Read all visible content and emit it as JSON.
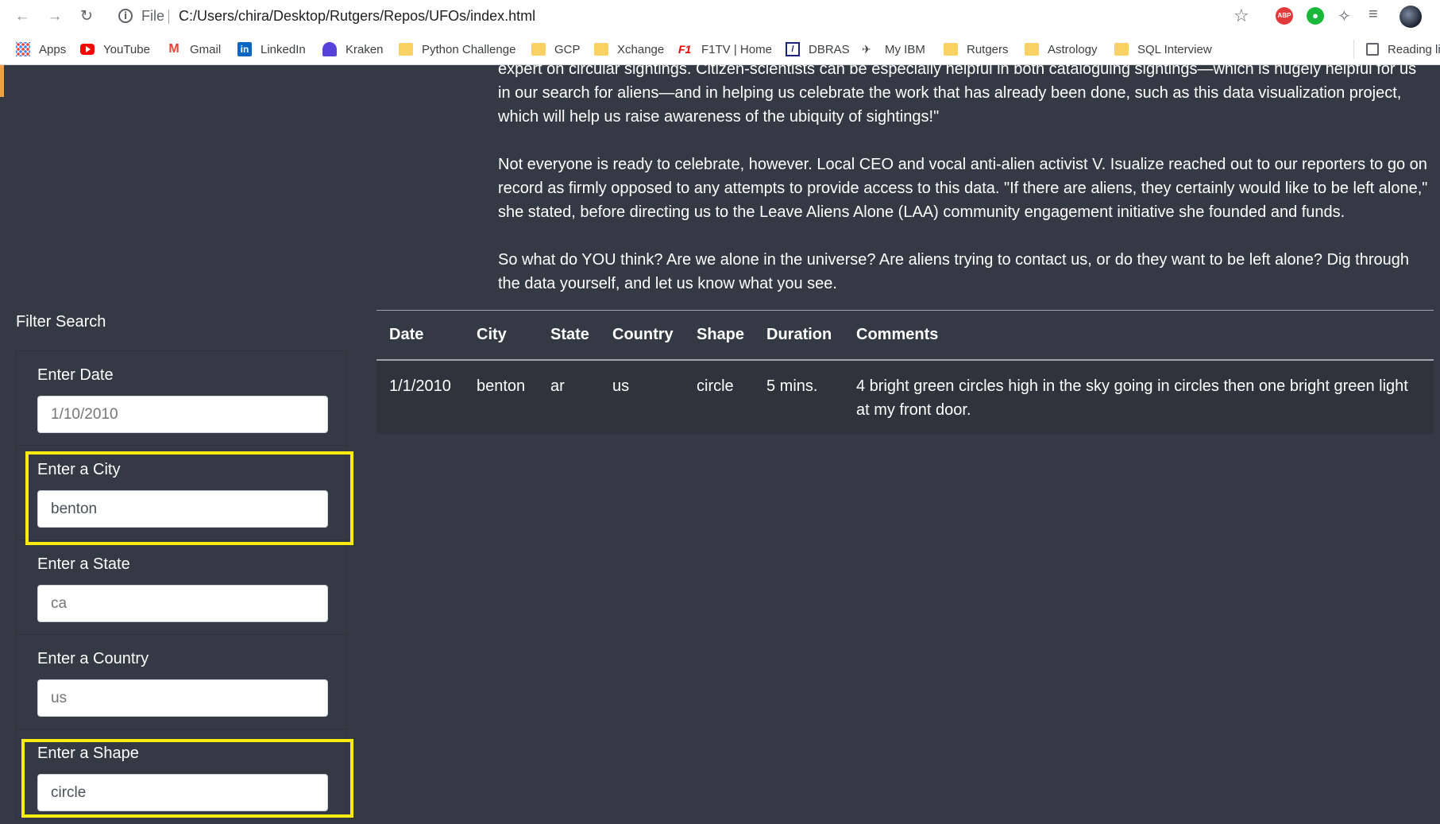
{
  "browser": {
    "scheme": "File",
    "url": "C:/Users/chira/Desktop/Rutgers/Repos/UFOs/index.html",
    "abp_label": "ABP",
    "bookmarks": [
      {
        "label": "Apps",
        "icon": "apps-grid-icon"
      },
      {
        "label": "YouTube",
        "icon": "youtube-icon"
      },
      {
        "label": "Gmail",
        "icon": "gmail-icon"
      },
      {
        "label": "LinkedIn",
        "icon": "linkedin-icon"
      },
      {
        "label": "Kraken",
        "icon": "kraken-icon"
      },
      {
        "label": "Python Challenge",
        "icon": "folder-icon"
      },
      {
        "label": "GCP",
        "icon": "folder-icon"
      },
      {
        "label": "Xchange",
        "icon": "folder-icon"
      },
      {
        "label": "F1TV | Home",
        "icon": "f1-icon"
      },
      {
        "label": "DBRAS",
        "icon": "dbras-icon"
      },
      {
        "label": "My IBM",
        "icon": "ibm-icon"
      },
      {
        "label": "Rutgers",
        "icon": "folder-icon"
      },
      {
        "label": "Astrology",
        "icon": "folder-icon"
      },
      {
        "label": "SQL Interview",
        "icon": "folder-icon"
      }
    ],
    "reading_list": "Reading li"
  },
  "article": {
    "p1_clipped": "expert on circular sightings.  Citizen-scientists can be especially helpful in both cataloguing sightings—which is hugely helpful for us in our search for aliens—and in helping us celebrate the work that has already been done, such as this data visualization project, which will help us raise awareness of the ubiquity of sightings!\"",
    "p2": "Not everyone is ready to celebrate, however. Local CEO and vocal anti-alien activist V. Isualize reached out to our reporters to go on record as firmly opposed to any attempts to provide access to this data. \"If there are aliens, they certainly would like to be left alone,\" she stated, before directing us to the Leave Aliens Alone (LAA) community engagement initiative she founded and funds.",
    "p3": "So what do YOU think? Are we alone in the universe? Are aliens trying to contact us, or do they want to be left alone? Dig through the data yourself, and let us know what you see."
  },
  "filters": {
    "title": "Filter Search",
    "date": {
      "label": "Enter Date",
      "placeholder": "1/10/2010"
    },
    "city": {
      "label": "Enter a City",
      "value": "benton"
    },
    "state": {
      "label": "Enter a State",
      "placeholder": "ca"
    },
    "country": {
      "label": "Enter a Country",
      "placeholder": "us"
    },
    "shape": {
      "label": "Enter a Shape",
      "value": "circle"
    }
  },
  "table": {
    "headers": [
      "Date",
      "City",
      "State",
      "Country",
      "Shape",
      "Duration",
      "Comments"
    ],
    "rows": [
      [
        "1/1/2010",
        "benton",
        "ar",
        "us",
        "circle",
        "5 mins.",
        "4 bright green circles high in the sky going in circles then one bright green light at my front door."
      ]
    ]
  },
  "colors": {
    "page_bg": "#343a43",
    "highlight": "#ffeb0f"
  }
}
